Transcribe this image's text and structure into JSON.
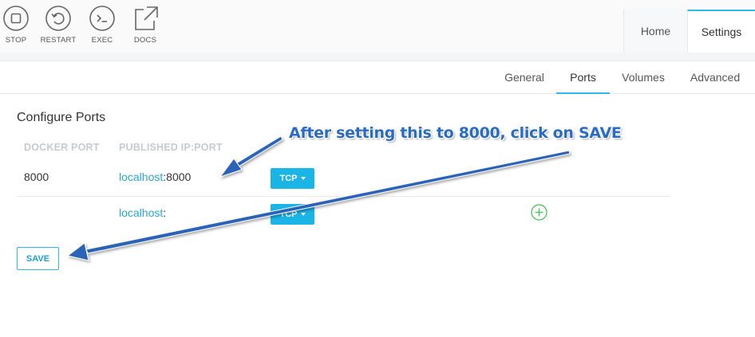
{
  "toolbar": {
    "items": [
      {
        "label": "STOP",
        "icon": "stop-icon"
      },
      {
        "label": "RESTART",
        "icon": "restart-icon"
      },
      {
        "label": "EXEC",
        "icon": "terminal-icon"
      },
      {
        "label": "DOCS",
        "icon": "external-link-icon"
      }
    ]
  },
  "main_tabs": [
    {
      "label": "Home",
      "active": false
    },
    {
      "label": "Settings",
      "active": true
    }
  ],
  "sub_tabs": [
    {
      "label": "General",
      "active": false
    },
    {
      "label": "Ports",
      "active": true
    },
    {
      "label": "Volumes",
      "active": false
    },
    {
      "label": "Advanced",
      "active": false
    }
  ],
  "ports": {
    "title": "Configure Ports",
    "columns": [
      "DOCKER PORT",
      "PUBLISHED IP:PORT"
    ],
    "rows": [
      {
        "docker_port": "8000",
        "host": "localhost",
        "separator": ":",
        "published_port": "8000",
        "protocol": "TCP"
      },
      {
        "docker_port": "",
        "host": "localhost",
        "separator": ":",
        "published_port": "",
        "protocol": "TCP"
      }
    ],
    "add_icon": "plus-circle-icon",
    "save_label": "SAVE"
  },
  "annotation": {
    "text": "After setting this to 8000, click on SAVE"
  },
  "colors": {
    "accent": "#2dbbe6",
    "tcp_button": "#1ab4e6",
    "link": "#2ba6cf",
    "add_icon": "#3cc24c",
    "annotation_arrow": "#2a63b8",
    "annotation_text": "#2a6cc4"
  }
}
